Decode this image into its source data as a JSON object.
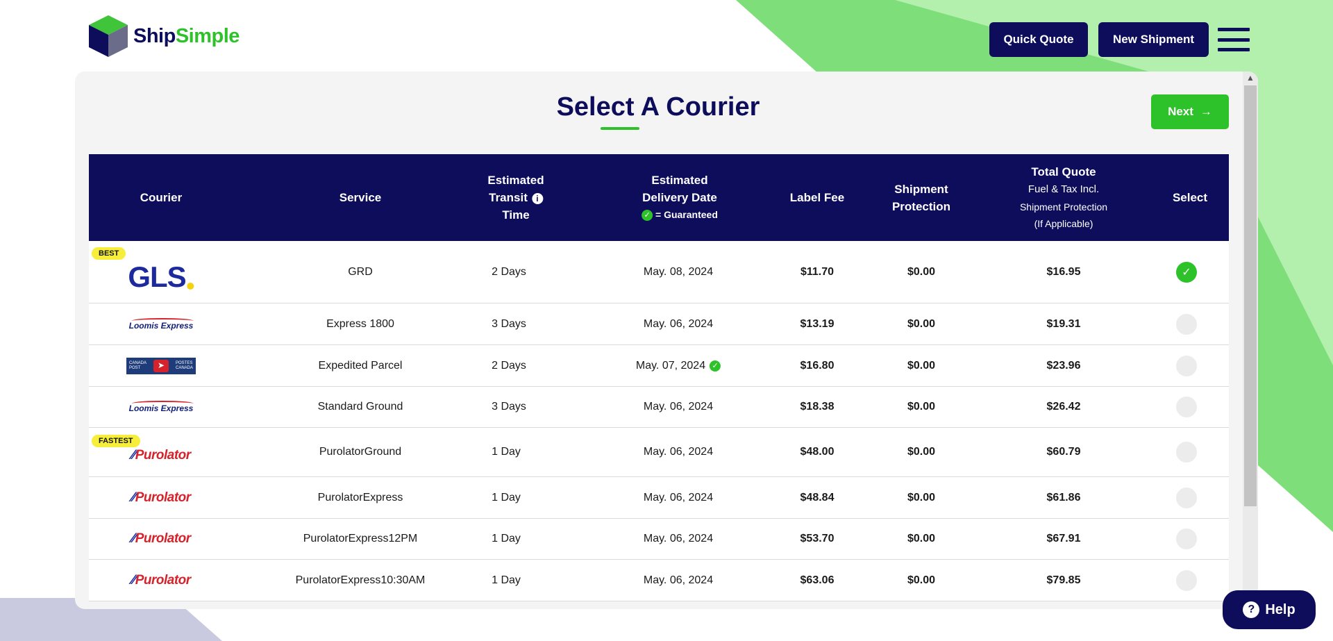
{
  "brand": {
    "name_part1": "Ship",
    "name_part2": "Simple"
  },
  "header": {
    "quick_quote_label": "Quick Quote",
    "new_shipment_label": "New Shipment"
  },
  "page": {
    "title": "Select A Courier",
    "next_label": "Next"
  },
  "table": {
    "headers": {
      "courier": "Courier",
      "service": "Service",
      "transit_l1": "Estimated",
      "transit_l2": "Transit",
      "transit_l3": "Time",
      "delivery_l1": "Estimated",
      "delivery_l2": "Delivery Date",
      "delivery_guaranteed": "= Guaranteed",
      "label_fee": "Label Fee",
      "protection_l1": "Shipment",
      "protection_l2": "Protection",
      "total_l1": "Total Quote",
      "total_l2": "Fuel & Tax Incl.",
      "total_l3": "Shipment Protection",
      "total_l4": "(If Applicable)",
      "select": "Select"
    },
    "rows": [
      {
        "courier_logo": "GLS",
        "badge": "BEST",
        "service": "GRD",
        "transit": "2 Days",
        "delivery": "May. 08, 2024",
        "guaranteed": false,
        "label_fee": "$11.70",
        "protection": "$0.00",
        "total": "$16.95",
        "selected": true
      },
      {
        "courier_logo": "Loomis Express",
        "badge": "",
        "service": "Express 1800",
        "transit": "3 Days",
        "delivery": "May. 06, 2024",
        "guaranteed": false,
        "label_fee": "$13.19",
        "protection": "$0.00",
        "total": "$19.31",
        "selected": false
      },
      {
        "courier_logo": "Canada Post",
        "badge": "",
        "service": "Expedited Parcel",
        "transit": "2 Days",
        "delivery": "May. 07, 2024",
        "guaranteed": true,
        "label_fee": "$16.80",
        "protection": "$0.00",
        "total": "$23.96",
        "selected": false
      },
      {
        "courier_logo": "Loomis Express",
        "badge": "",
        "service": "Standard Ground",
        "transit": "3 Days",
        "delivery": "May. 06, 2024",
        "guaranteed": false,
        "label_fee": "$18.38",
        "protection": "$0.00",
        "total": "$26.42",
        "selected": false
      },
      {
        "courier_logo": "Purolator",
        "badge": "FASTEST",
        "service": "PurolatorGround",
        "transit": "1 Day",
        "delivery": "May. 06, 2024",
        "guaranteed": false,
        "label_fee": "$48.00",
        "protection": "$0.00",
        "total": "$60.79",
        "selected": false
      },
      {
        "courier_logo": "Purolator",
        "badge": "",
        "service": "PurolatorExpress",
        "transit": "1 Day",
        "delivery": "May. 06, 2024",
        "guaranteed": false,
        "label_fee": "$48.84",
        "protection": "$0.00",
        "total": "$61.86",
        "selected": false
      },
      {
        "courier_logo": "Purolator",
        "badge": "",
        "service": "PurolatorExpress12PM",
        "transit": "1 Day",
        "delivery": "May. 06, 2024",
        "guaranteed": false,
        "label_fee": "$53.70",
        "protection": "$0.00",
        "total": "$67.91",
        "selected": false
      },
      {
        "courier_logo": "Purolator",
        "badge": "",
        "service": "PurolatorExpress10:30AM",
        "transit": "1 Day",
        "delivery": "May. 06, 2024",
        "guaranteed": false,
        "label_fee": "$63.06",
        "protection": "$0.00",
        "total": "$79.85",
        "selected": false
      }
    ]
  },
  "help": {
    "label": "Help"
  },
  "colors": {
    "navy": "#0d0d5c",
    "green": "#2ec22a",
    "badge_yellow": "#f6ee3a"
  }
}
